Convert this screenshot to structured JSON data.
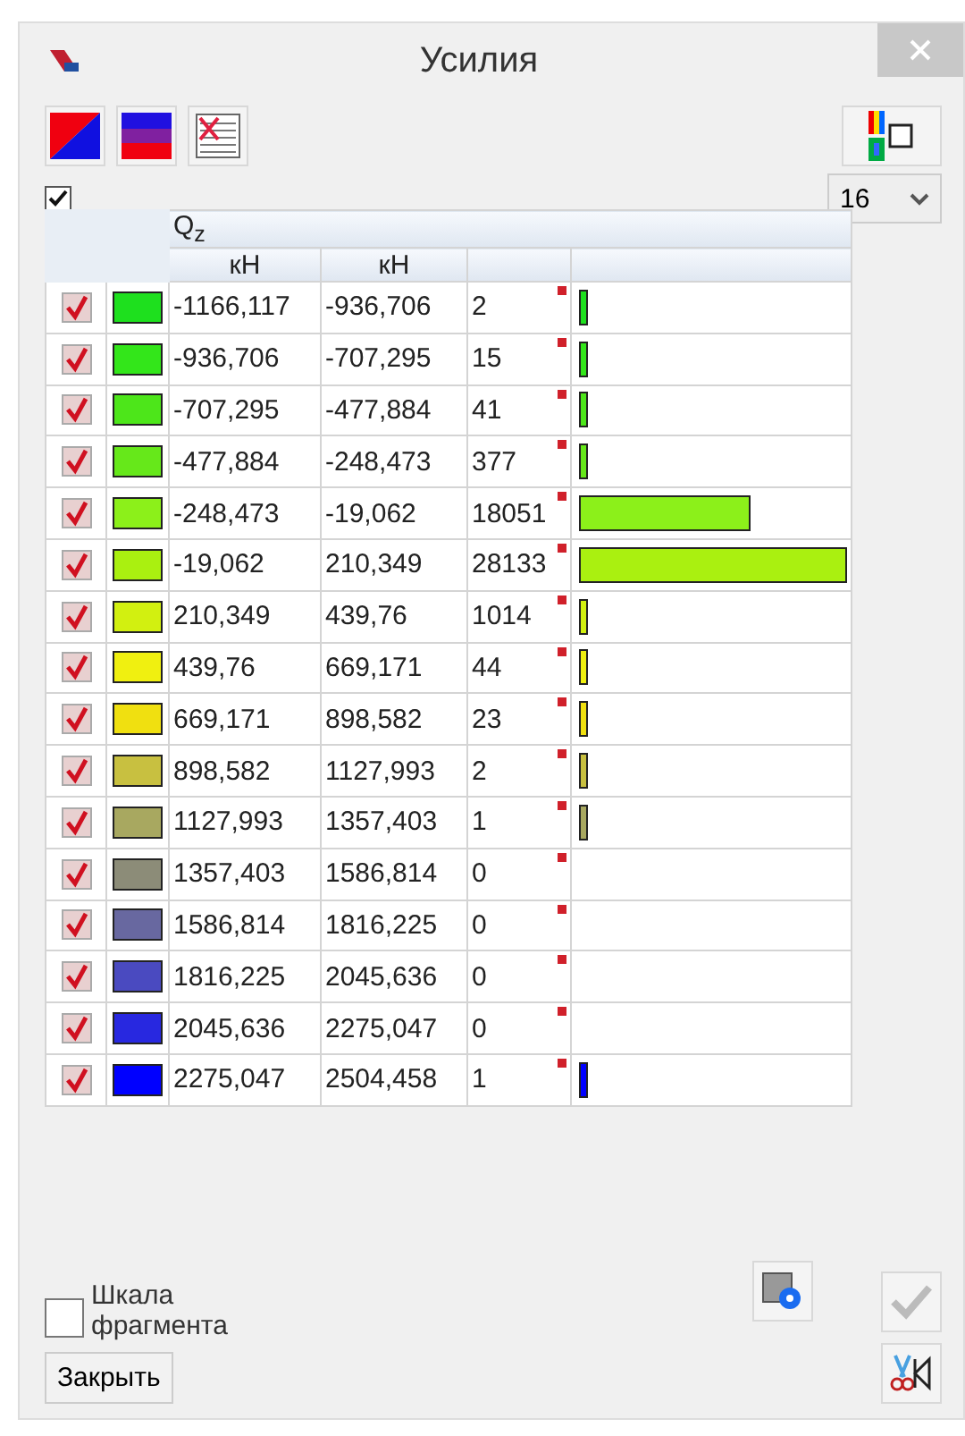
{
  "window": {
    "title": "Усилия"
  },
  "toolbar": {
    "show_all_checked": true,
    "count_select": "16"
  },
  "table": {
    "header": "Q$_{z}$",
    "units": [
      "кН",
      "кН"
    ],
    "rows": [
      {
        "checked": true,
        "color": "#1ee01e",
        "from": "-1166,117",
        "to": "-936,706",
        "count": "2",
        "level": 7e-05
      },
      {
        "checked": true,
        "color": "#33e61a",
        "from": "-936,706",
        "to": "-707,295",
        "count": "15",
        "level": 0.0005
      },
      {
        "checked": true,
        "color": "#4de61a",
        "from": "-707,295",
        "to": "-477,884",
        "count": "41",
        "level": 0.0015
      },
      {
        "checked": true,
        "color": "#66e81a",
        "from": "-477,884",
        "to": "-248,473",
        "count": "377",
        "level": 0.0134
      },
      {
        "checked": true,
        "color": "#8cf01a",
        "from": "-248,473",
        "to": "-19,062",
        "count": "18051",
        "level": 0.6416
      },
      {
        "checked": true,
        "color": "#aaf010",
        "from": "-19,062",
        "to": "210,349",
        "count": "28133",
        "level": 1
      },
      {
        "checked": true,
        "color": "#d2f010",
        "from": "210,349",
        "to": "439,76",
        "count": "1014",
        "level": 0.036
      },
      {
        "checked": true,
        "color": "#f0f010",
        "from": "439,76",
        "to": "669,171",
        "count": "44",
        "level": 0.0016
      },
      {
        "checked": true,
        "color": "#f0e010",
        "from": "669,171",
        "to": "898,582",
        "count": "23",
        "level": 0.0008
      },
      {
        "checked": true,
        "color": "#c8c040",
        "from": "898,582",
        "to": "1127,993",
        "count": "2",
        "level": 7e-05
      },
      {
        "checked": true,
        "color": "#a8a860",
        "from": "1127,993",
        "to": "1357,403",
        "count": "1",
        "level": 4e-05
      },
      {
        "checked": true,
        "color": "#8c8c78",
        "from": "1357,403",
        "to": "1586,814",
        "count": "0",
        "level": 0
      },
      {
        "checked": true,
        "color": "#6868a0",
        "from": "1586,814",
        "to": "1816,225",
        "count": "0",
        "level": 0
      },
      {
        "checked": true,
        "color": "#4a4ac0",
        "from": "1816,225",
        "to": "2045,636",
        "count": "0",
        "level": 0
      },
      {
        "checked": true,
        "color": "#2828e0",
        "from": "2045,636",
        "to": "2275,047",
        "count": "0",
        "level": 0
      },
      {
        "checked": true,
        "color": "#0000ff",
        "from": "2275,047",
        "to": "2504,458",
        "count": "1",
        "level": 4e-05
      }
    ]
  },
  "fragment_scale": {
    "label": "Шкала фрагмента",
    "checked": false
  },
  "close_button": "Закрыть"
}
